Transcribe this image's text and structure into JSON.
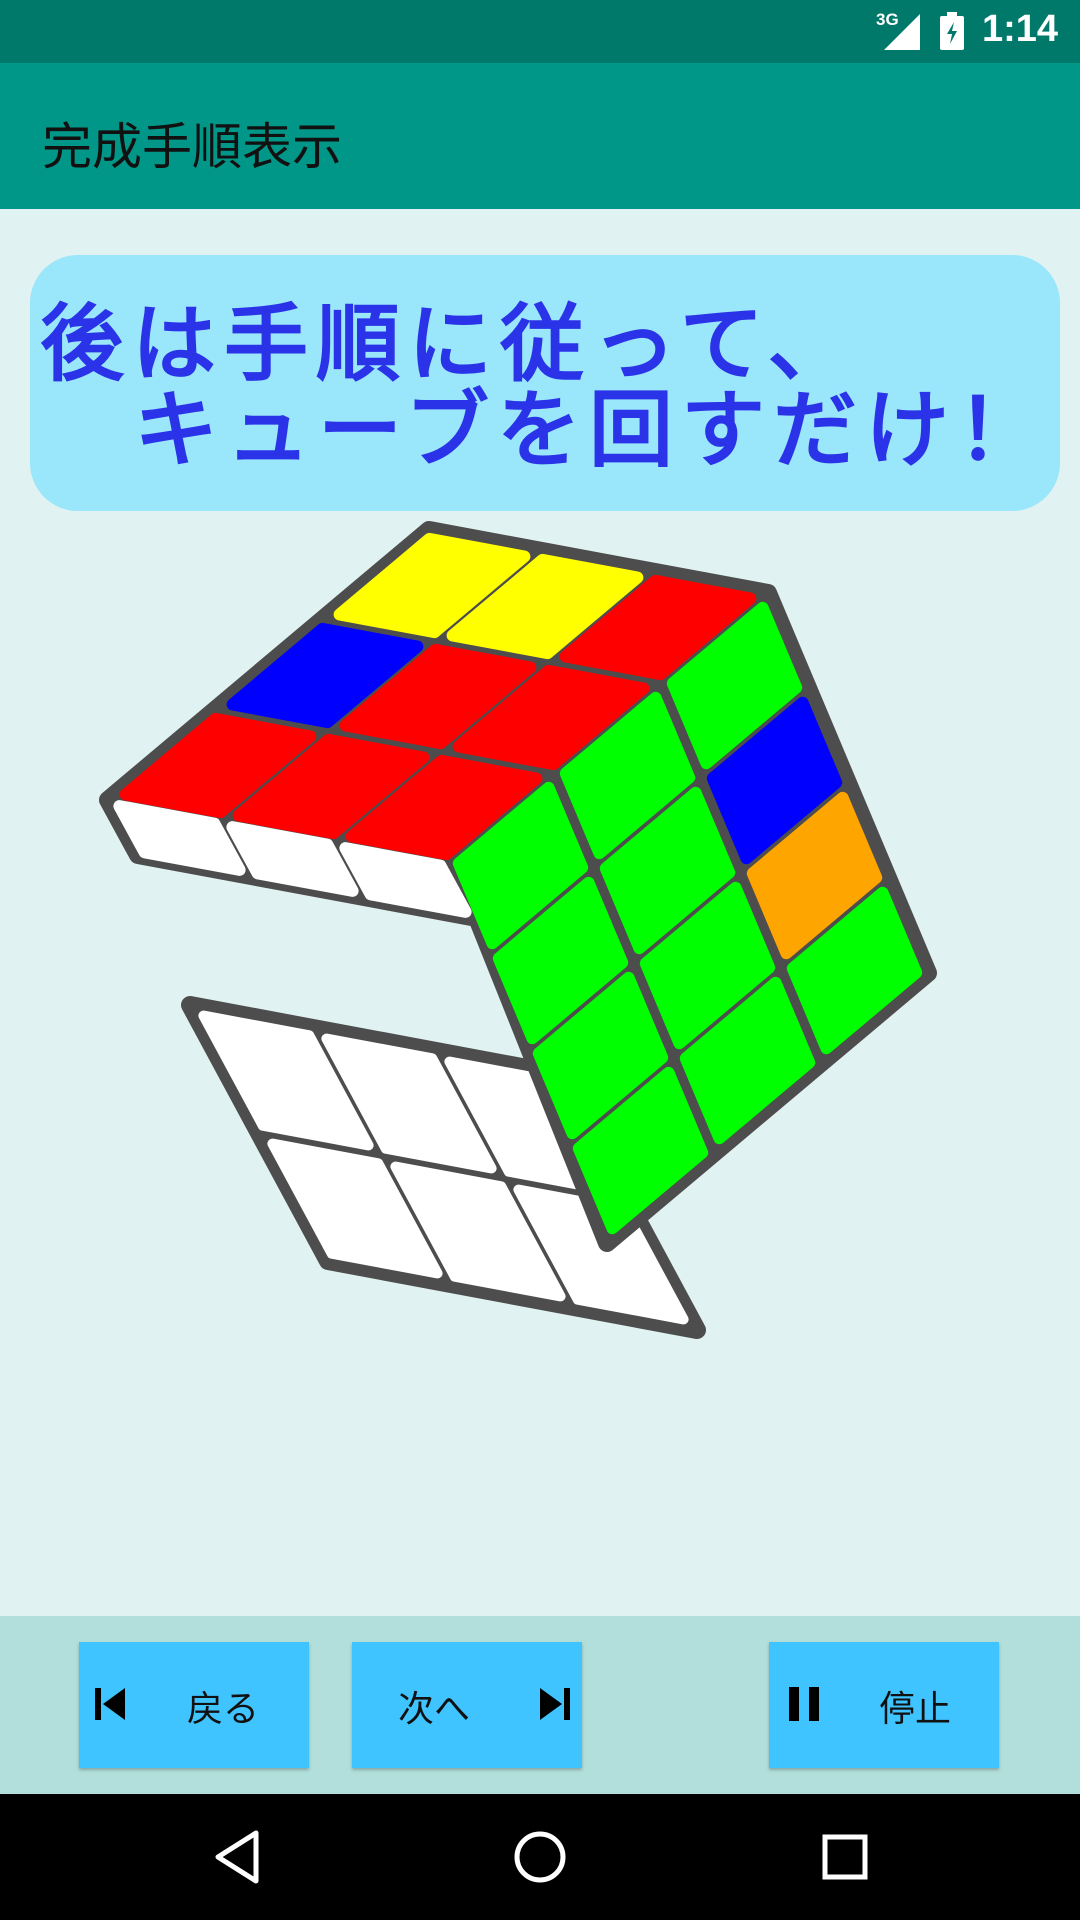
{
  "status_bar": {
    "network": "3G",
    "time": "1:14"
  },
  "app_bar": {
    "title": "完成手順表示"
  },
  "message": {
    "line1": "後は手順に従って、",
    "line2": "キューブを回すだけ！"
  },
  "cube": {
    "colors": {
      "Y": "#ffff00",
      "R": "#ff0000",
      "B": "#0000ff",
      "G": "#00ff00",
      "O": "#ffa500",
      "W": "#ffffff",
      "body": "#4d4d4d"
    },
    "top_face": [
      [
        "Y",
        "Y",
        "R"
      ],
      [
        "B",
        "R",
        "R"
      ],
      [
        "R",
        "R",
        "R"
      ]
    ],
    "right_face": [
      [
        "G",
        "G",
        "G"
      ],
      [
        "G",
        "G",
        "B"
      ],
      [
        "G",
        "G",
        "O"
      ],
      [
        "G",
        "G",
        "G"
      ]
    ],
    "front_top_row": [
      "W",
      "W",
      "W"
    ],
    "front_lower_rows": [
      [
        "W",
        "W",
        "W"
      ],
      [
        "W",
        "W",
        "W"
      ]
    ]
  },
  "controls": {
    "back_label": "戻る",
    "next_label": "次へ",
    "stop_label": "停止"
  },
  "nav": {
    "back": "back-icon",
    "home": "home-icon",
    "recents": "recents-icon"
  }
}
